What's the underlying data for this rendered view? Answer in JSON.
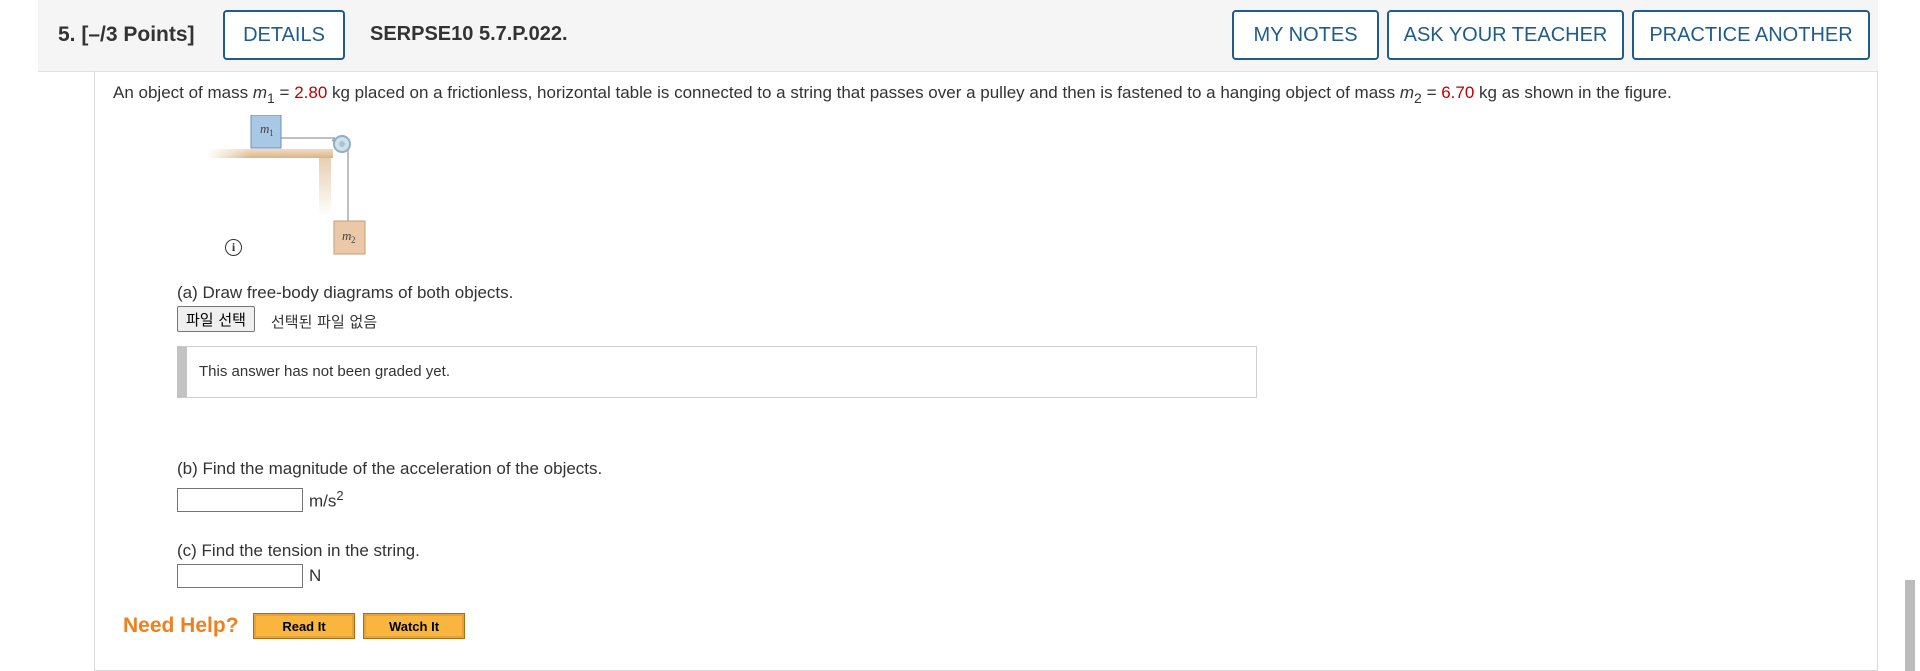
{
  "header": {
    "question_number": "5.  [–/3 Points]",
    "details_label": "DETAILS",
    "question_id": "SERPSE10 5.7.P.022.",
    "my_notes_label": "MY NOTES",
    "ask_teacher_label": "ASK YOUR TEACHER",
    "practice_another_label": "PRACTICE ANOTHER"
  },
  "problem": {
    "text_1": "An object of mass ",
    "m1_symbol": "m",
    "m1_sub": "1",
    "eq_1": " = ",
    "m1_value": "2.80",
    "text_2": " kg placed on a frictionless, horizontal table is connected to a string that passes over a pulley and then is fastened to a hanging object of mass ",
    "m2_symbol": "m",
    "m2_sub": "2",
    "eq_2": " = ",
    "m2_value": "6.70",
    "text_3": " kg as shown in the figure."
  },
  "figure": {
    "m1_label": "m",
    "m1_label_sub": "1",
    "m2_label": "m",
    "m2_label_sub": "2",
    "info_icon_glyph": "i"
  },
  "part_a": {
    "question": "(a) Draw free-body diagrams of both objects.",
    "file_button_label": "파일 선택",
    "file_status": "선택된 파일 없음",
    "graded_message": "This answer has not been graded yet."
  },
  "part_b": {
    "question": "(b) Find the magnitude of the acceleration of the objects.",
    "input_value": "",
    "unit": "m/s",
    "unit_exp": "2"
  },
  "part_c": {
    "question": "(c) Find the tension in the string.",
    "input_value": "",
    "unit": "N"
  },
  "help": {
    "label": "Need Help?",
    "read_it_label": "Read It",
    "watch_it_label": "Watch It"
  },
  "colors": {
    "accent": "#1f5c8c",
    "value_red": "#c00000",
    "help_orange": "#f07f1e",
    "help_button": "#f8b63e"
  }
}
